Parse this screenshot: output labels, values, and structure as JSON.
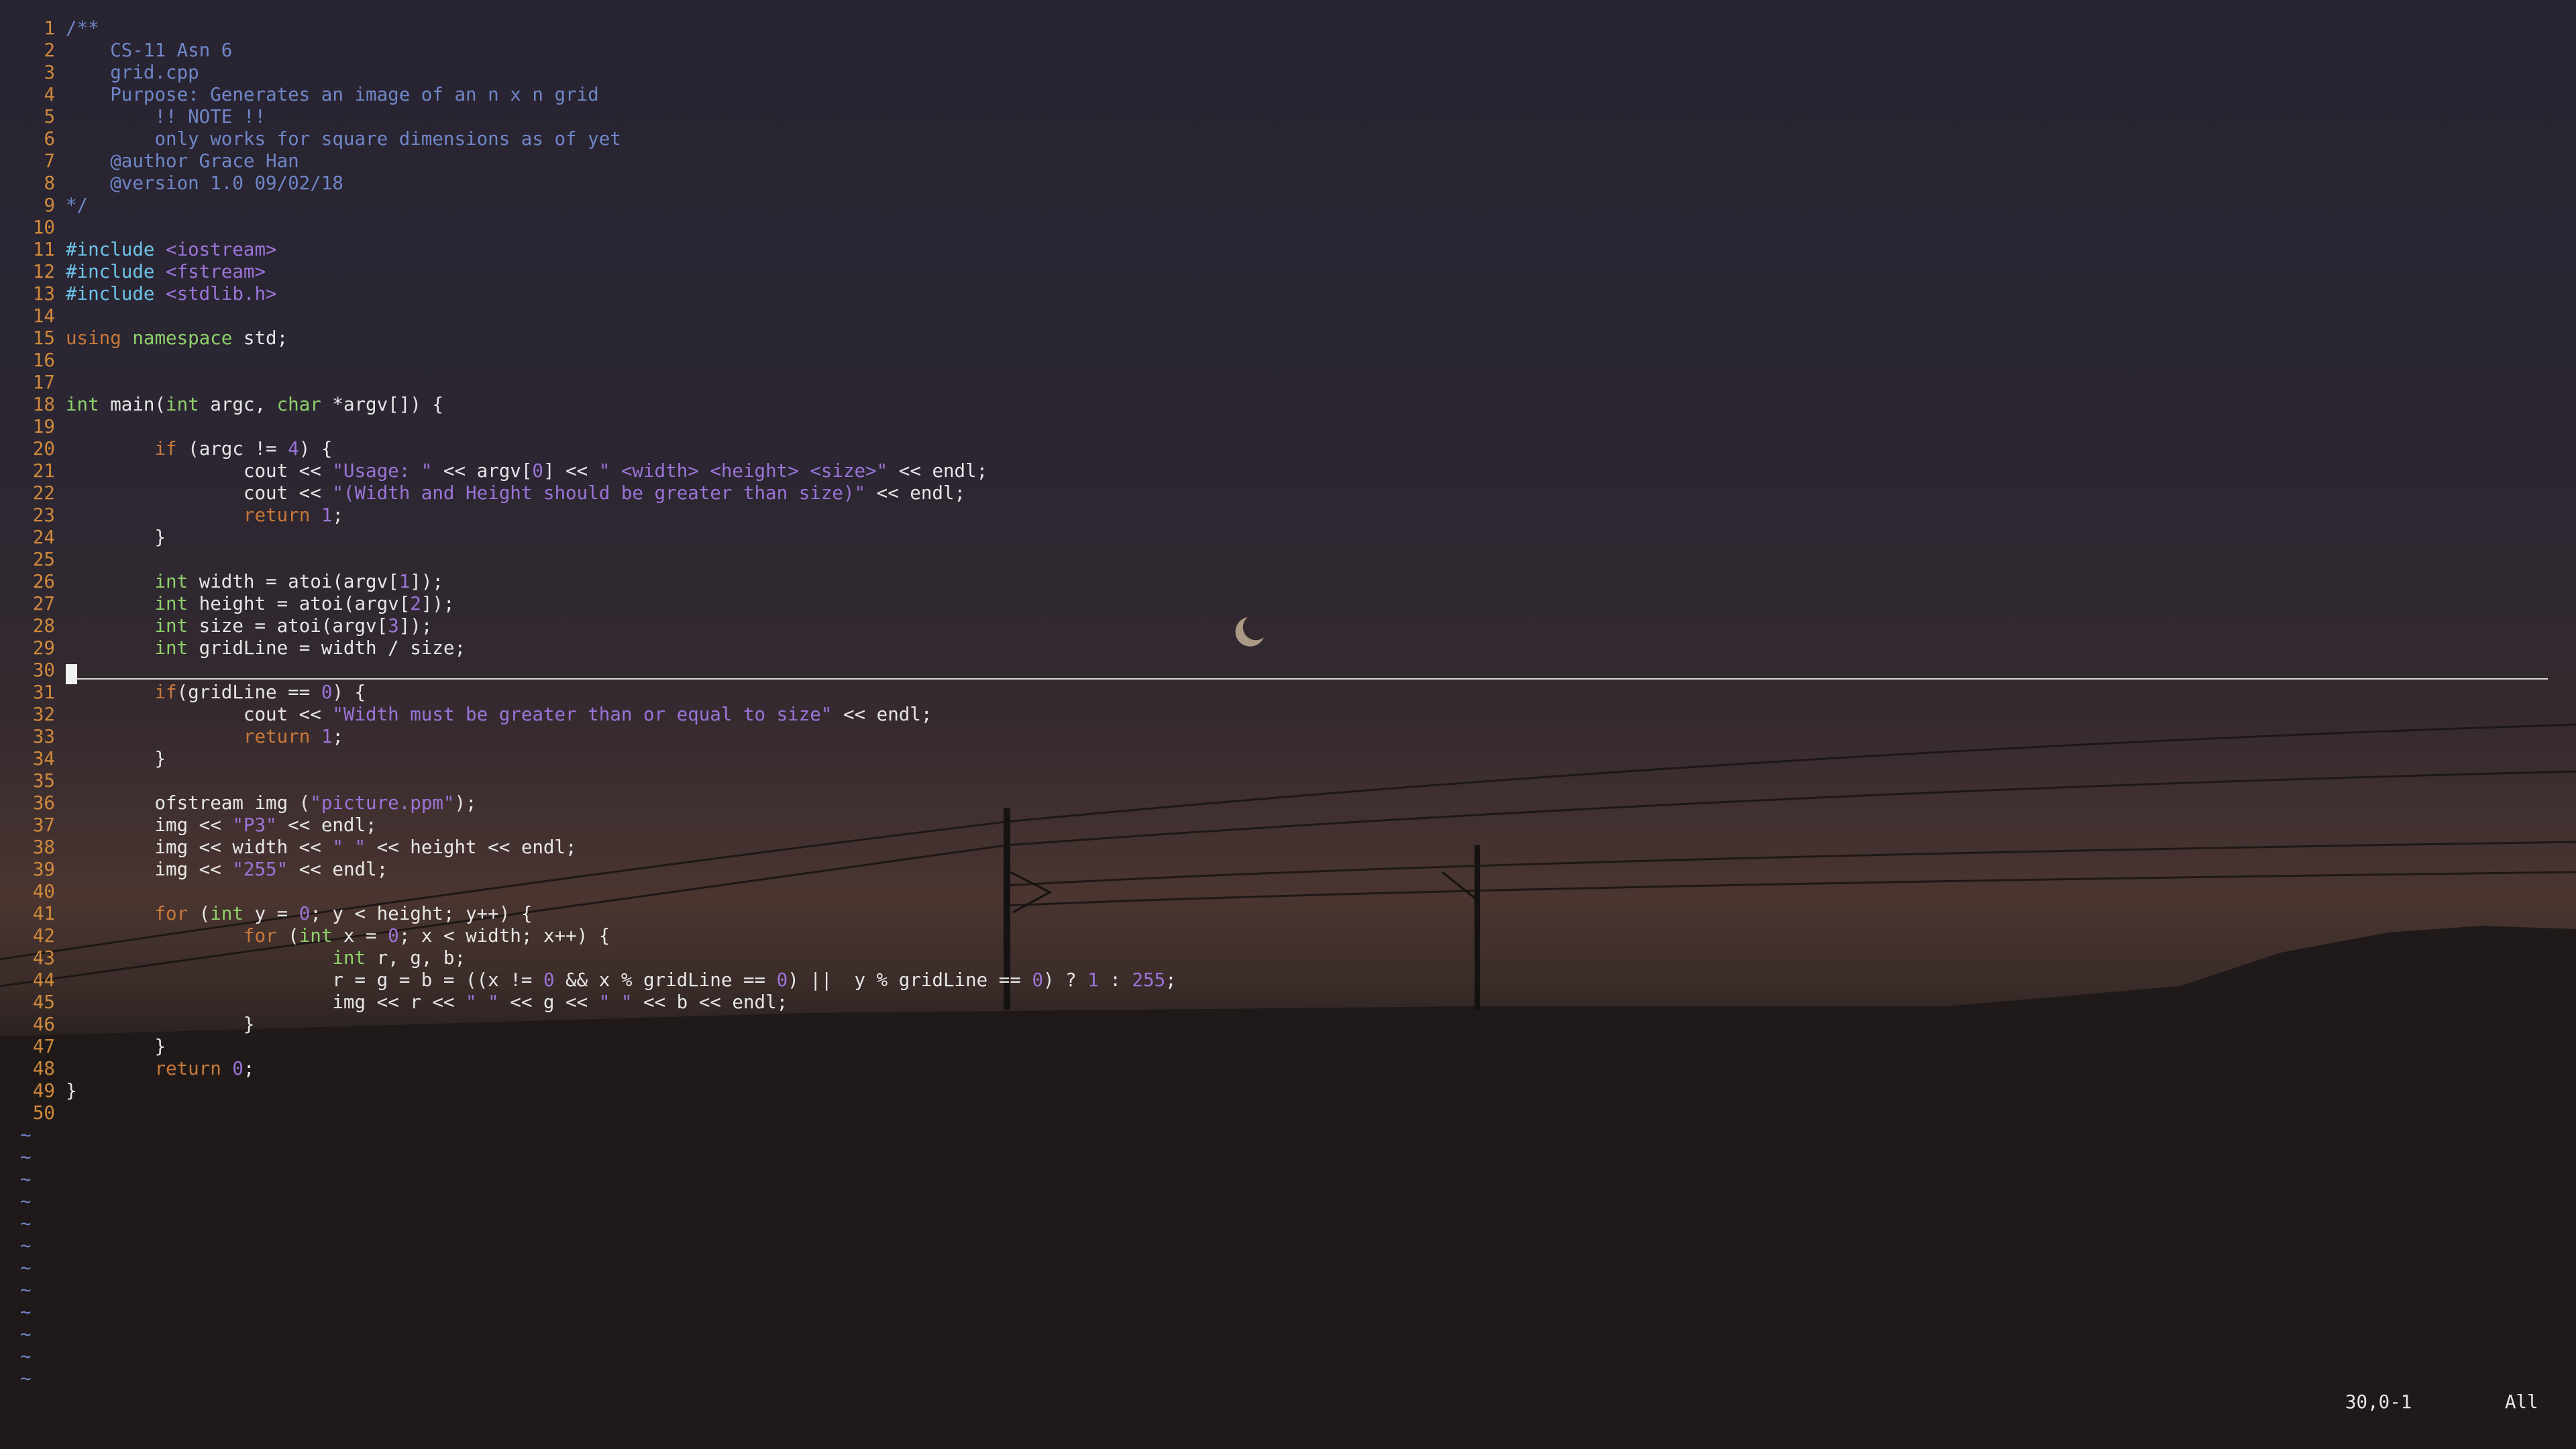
{
  "editor": {
    "filename": "grid.cpp",
    "lines": [
      {
        "n": "1",
        "t": [
          {
            "c": "com",
            "s": "/**"
          }
        ]
      },
      {
        "n": "2",
        "t": [
          {
            "c": "com",
            "s": "    CS-11 Asn 6"
          }
        ]
      },
      {
        "n": "3",
        "t": [
          {
            "c": "com",
            "s": "    grid.cpp"
          }
        ]
      },
      {
        "n": "4",
        "t": [
          {
            "c": "com",
            "s": "    Purpose: Generates an image of an n x n grid"
          }
        ]
      },
      {
        "n": "5",
        "t": [
          {
            "c": "com",
            "s": "        !! NOTE !!"
          }
        ]
      },
      {
        "n": "6",
        "t": [
          {
            "c": "com",
            "s": "        only works for square dimensions as of yet"
          }
        ]
      },
      {
        "n": "7",
        "t": [
          {
            "c": "com",
            "s": "    @author Grace Han"
          }
        ]
      },
      {
        "n": "8",
        "t": [
          {
            "c": "com",
            "s": "    @version 1.0 09/02/18"
          }
        ]
      },
      {
        "n": "9",
        "t": [
          {
            "c": "com",
            "s": "*/"
          }
        ]
      },
      {
        "n": "10",
        "t": []
      },
      {
        "n": "11",
        "t": [
          {
            "c": "pre",
            "s": "#include "
          },
          {
            "c": "str",
            "s": "<iostream>"
          }
        ]
      },
      {
        "n": "12",
        "t": [
          {
            "c": "pre",
            "s": "#include "
          },
          {
            "c": "str",
            "s": "<fstream>"
          }
        ]
      },
      {
        "n": "13",
        "t": [
          {
            "c": "pre",
            "s": "#include "
          },
          {
            "c": "str",
            "s": "<stdlib.h>"
          }
        ]
      },
      {
        "n": "14",
        "t": []
      },
      {
        "n": "15",
        "t": [
          {
            "c": "kw",
            "s": "using "
          },
          {
            "c": "typ",
            "s": "namespace"
          },
          {
            "c": "",
            "s": " std;"
          }
        ]
      },
      {
        "n": "16",
        "t": []
      },
      {
        "n": "17",
        "t": []
      },
      {
        "n": "18",
        "t": [
          {
            "c": "typ",
            "s": "int"
          },
          {
            "c": "",
            "s": " main("
          },
          {
            "c": "typ",
            "s": "int"
          },
          {
            "c": "",
            "s": " argc, "
          },
          {
            "c": "typ",
            "s": "char"
          },
          {
            "c": "",
            "s": " *argv[]) {"
          }
        ]
      },
      {
        "n": "19",
        "t": []
      },
      {
        "n": "20",
        "t": [
          {
            "c": "",
            "s": "        "
          },
          {
            "c": "kw",
            "s": "if"
          },
          {
            "c": "",
            "s": " (argc != "
          },
          {
            "c": "num",
            "s": "4"
          },
          {
            "c": "",
            "s": ") {"
          }
        ]
      },
      {
        "n": "21",
        "t": [
          {
            "c": "",
            "s": "                cout << "
          },
          {
            "c": "str",
            "s": "\"Usage: \""
          },
          {
            "c": "",
            "s": " << argv["
          },
          {
            "c": "num",
            "s": "0"
          },
          {
            "c": "",
            "s": "] << "
          },
          {
            "c": "str",
            "s": "\" <width> <height> <size>\""
          },
          {
            "c": "",
            "s": " << endl;"
          }
        ]
      },
      {
        "n": "22",
        "t": [
          {
            "c": "",
            "s": "                cout << "
          },
          {
            "c": "str",
            "s": "\"(Width and Height should be greater than size)\""
          },
          {
            "c": "",
            "s": " << endl;"
          }
        ]
      },
      {
        "n": "23",
        "t": [
          {
            "c": "",
            "s": "                "
          },
          {
            "c": "kw",
            "s": "return"
          },
          {
            "c": "",
            "s": " "
          },
          {
            "c": "num",
            "s": "1"
          },
          {
            "c": "",
            "s": ";"
          }
        ]
      },
      {
        "n": "24",
        "t": [
          {
            "c": "",
            "s": "        }"
          }
        ]
      },
      {
        "n": "25",
        "t": []
      },
      {
        "n": "26",
        "t": [
          {
            "c": "",
            "s": "        "
          },
          {
            "c": "typ",
            "s": "int"
          },
          {
            "c": "",
            "s": " width = atoi(argv["
          },
          {
            "c": "num",
            "s": "1"
          },
          {
            "c": "",
            "s": "]);"
          }
        ]
      },
      {
        "n": "27",
        "t": [
          {
            "c": "",
            "s": "        "
          },
          {
            "c": "typ",
            "s": "int"
          },
          {
            "c": "",
            "s": " height = atoi(argv["
          },
          {
            "c": "num",
            "s": "2"
          },
          {
            "c": "",
            "s": "]);"
          }
        ]
      },
      {
        "n": "28",
        "t": [
          {
            "c": "",
            "s": "        "
          },
          {
            "c": "typ",
            "s": "int"
          },
          {
            "c": "",
            "s": " size = atoi(argv["
          },
          {
            "c": "num",
            "s": "3"
          },
          {
            "c": "",
            "s": "]);"
          }
        ]
      },
      {
        "n": "29",
        "t": [
          {
            "c": "",
            "s": "        "
          },
          {
            "c": "typ",
            "s": "int"
          },
          {
            "c": "",
            "s": " gridLine = width / size;"
          }
        ]
      },
      {
        "n": "30",
        "t": []
      },
      {
        "n": "31",
        "t": [
          {
            "c": "",
            "s": "        "
          },
          {
            "c": "kw",
            "s": "if"
          },
          {
            "c": "",
            "s": "(gridLine == "
          },
          {
            "c": "num",
            "s": "0"
          },
          {
            "c": "",
            "s": ") {"
          }
        ]
      },
      {
        "n": "32",
        "t": [
          {
            "c": "",
            "s": "                cout << "
          },
          {
            "c": "str",
            "s": "\"Width must be greater than or equal to size\""
          },
          {
            "c": "",
            "s": " << endl;"
          }
        ]
      },
      {
        "n": "33",
        "t": [
          {
            "c": "",
            "s": "                "
          },
          {
            "c": "kw",
            "s": "return"
          },
          {
            "c": "",
            "s": " "
          },
          {
            "c": "num",
            "s": "1"
          },
          {
            "c": "",
            "s": ";"
          }
        ]
      },
      {
        "n": "34",
        "t": [
          {
            "c": "",
            "s": "        }"
          }
        ]
      },
      {
        "n": "35",
        "t": []
      },
      {
        "n": "36",
        "t": [
          {
            "c": "",
            "s": "        ofstream img ("
          },
          {
            "c": "str",
            "s": "\"picture.ppm\""
          },
          {
            "c": "",
            "s": ");"
          }
        ]
      },
      {
        "n": "37",
        "t": [
          {
            "c": "",
            "s": "        img << "
          },
          {
            "c": "str",
            "s": "\"P3\""
          },
          {
            "c": "",
            "s": " << endl;"
          }
        ]
      },
      {
        "n": "38",
        "t": [
          {
            "c": "",
            "s": "        img << width << "
          },
          {
            "c": "str",
            "s": "\" \""
          },
          {
            "c": "",
            "s": " << height << endl;"
          }
        ]
      },
      {
        "n": "39",
        "t": [
          {
            "c": "",
            "s": "        img << "
          },
          {
            "c": "str",
            "s": "\"255\""
          },
          {
            "c": "",
            "s": " << endl;"
          }
        ]
      },
      {
        "n": "40",
        "t": []
      },
      {
        "n": "41",
        "t": [
          {
            "c": "",
            "s": "        "
          },
          {
            "c": "kw",
            "s": "for"
          },
          {
            "c": "",
            "s": " ("
          },
          {
            "c": "typ",
            "s": "int"
          },
          {
            "c": "",
            "s": " y = "
          },
          {
            "c": "num",
            "s": "0"
          },
          {
            "c": "",
            "s": "; y < height; y++) {"
          }
        ]
      },
      {
        "n": "42",
        "t": [
          {
            "c": "",
            "s": "                "
          },
          {
            "c": "kw",
            "s": "for"
          },
          {
            "c": "",
            "s": " ("
          },
          {
            "c": "typ",
            "s": "int"
          },
          {
            "c": "",
            "s": " x = "
          },
          {
            "c": "num",
            "s": "0"
          },
          {
            "c": "",
            "s": "; x < width; x++) {"
          }
        ]
      },
      {
        "n": "43",
        "t": [
          {
            "c": "",
            "s": "                        "
          },
          {
            "c": "typ",
            "s": "int"
          },
          {
            "c": "",
            "s": " r, g, b;"
          }
        ]
      },
      {
        "n": "44",
        "t": [
          {
            "c": "",
            "s": "                        r = g = b = ((x != "
          },
          {
            "c": "num",
            "s": "0"
          },
          {
            "c": "",
            "s": " && x % gridLine == "
          },
          {
            "c": "num",
            "s": "0"
          },
          {
            "c": "",
            "s": ") ||  y % gridLine == "
          },
          {
            "c": "num",
            "s": "0"
          },
          {
            "c": "",
            "s": ") ? "
          },
          {
            "c": "num",
            "s": "1"
          },
          {
            "c": "",
            "s": " : "
          },
          {
            "c": "num",
            "s": "255"
          },
          {
            "c": "",
            "s": ";"
          }
        ]
      },
      {
        "n": "45",
        "t": [
          {
            "c": "",
            "s": "                        img << r << "
          },
          {
            "c": "str",
            "s": "\" \""
          },
          {
            "c": "",
            "s": " << g << "
          },
          {
            "c": "str",
            "s": "\" \""
          },
          {
            "c": "",
            "s": " << b << endl;"
          }
        ]
      },
      {
        "n": "46",
        "t": [
          {
            "c": "",
            "s": "                }"
          }
        ]
      },
      {
        "n": "47",
        "t": [
          {
            "c": "",
            "s": "        }"
          }
        ]
      },
      {
        "n": "48",
        "t": [
          {
            "c": "",
            "s": "        "
          },
          {
            "c": "kw",
            "s": "return"
          },
          {
            "c": "",
            "s": " "
          },
          {
            "c": "num",
            "s": "0"
          },
          {
            "c": "",
            "s": ";"
          }
        ]
      },
      {
        "n": "49",
        "t": [
          {
            "c": "",
            "s": "}"
          }
        ]
      },
      {
        "n": "50",
        "t": []
      }
    ],
    "tilde_rows": [
      "~",
      "~",
      "~",
      "~",
      "~",
      "~",
      "~",
      "~",
      "~",
      "~",
      "~",
      "~"
    ],
    "current_line": 30
  },
  "statusbar": {
    "position": "30,0-1",
    "scroll": "All"
  },
  "colors": {
    "comment": "#6f86c8",
    "keyword": "#c8783a",
    "type": "#8fd16c",
    "preproc": "#6cc4e8",
    "string": "#9b74d8",
    "line_number": "#d08a3c"
  }
}
